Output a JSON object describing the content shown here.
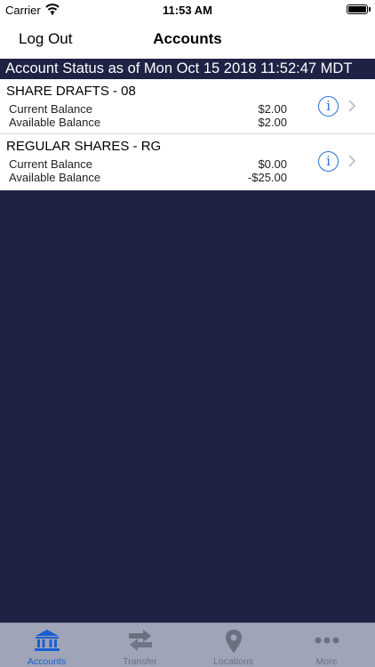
{
  "status_bar": {
    "carrier": "Carrier",
    "time": "11:53 AM"
  },
  "nav": {
    "left_button": "Log Out",
    "title": "Accounts"
  },
  "banner": {
    "text": "Account Status as of Mon Oct 15 2018 11:52:47 MDT"
  },
  "accounts": [
    {
      "name": "SHARE DRAFTS - 08",
      "current_label": "Current Balance",
      "current_value": "$2.00",
      "available_label": "Available Balance",
      "available_value": "$2.00"
    },
    {
      "name": "REGULAR SHARES - RG",
      "current_label": "Current Balance",
      "current_value": "$0.00",
      "available_label": "Available Balance",
      "available_value": "-$25.00"
    }
  ],
  "info_glyph": "i",
  "tabs": [
    {
      "label": "Accounts",
      "icon": "bank-icon",
      "active": true
    },
    {
      "label": "Transfer",
      "icon": "transfer-arrows-icon",
      "active": false
    },
    {
      "label": "Locations",
      "icon": "map-pin-icon",
      "active": false
    },
    {
      "label": "More",
      "icon": "more-dots-icon",
      "active": false
    }
  ],
  "colors": {
    "background": "#1e2244",
    "accent": "#1a5fd0",
    "tabbar": "#9fa4b8",
    "tab_inactive": "#6b6f80"
  }
}
